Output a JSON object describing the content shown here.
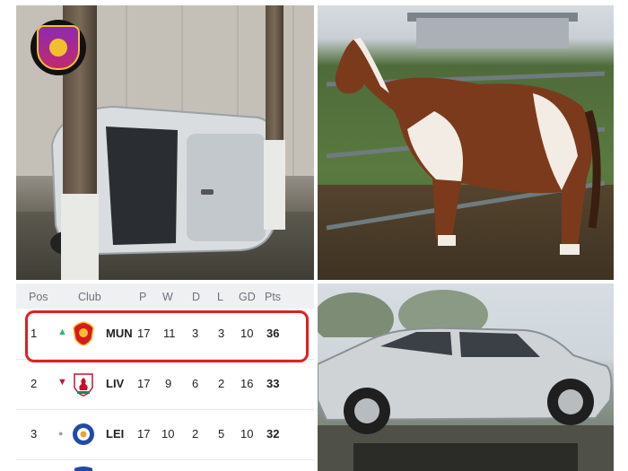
{
  "table": {
    "headers": [
      "Pos",
      "Club",
      "P",
      "W",
      "D",
      "L",
      "GD",
      "Pts"
    ],
    "rows": [
      {
        "pos": "1",
        "trend": "up",
        "club": "MUN",
        "p": "17",
        "w": "11",
        "d": "3",
        "l": "3",
        "gd": "10",
        "pts": "36"
      },
      {
        "pos": "2",
        "trend": "down",
        "club": "LIV",
        "p": "17",
        "w": "9",
        "d": "6",
        "l": "2",
        "gd": "16",
        "pts": "33"
      },
      {
        "pos": "3",
        "trend": "same",
        "club": "LEI",
        "p": "17",
        "w": "10",
        "d": "2",
        "l": "5",
        "gd": "10",
        "pts": "32"
      }
    ]
  },
  "colors": {
    "highlight": "#e02020",
    "up": "#2bb673",
    "down": "#d0103a",
    "same": "#9aa0a6",
    "mun_crest": "#d81920",
    "liv_crest": "#c8102e",
    "lei_crest": "#1f4aa8"
  },
  "icons": {
    "logo": "soccer-ball-badge-icon",
    "up": "triangle-up-icon",
    "down": "triangle-down-icon",
    "same": "dot-icon"
  }
}
